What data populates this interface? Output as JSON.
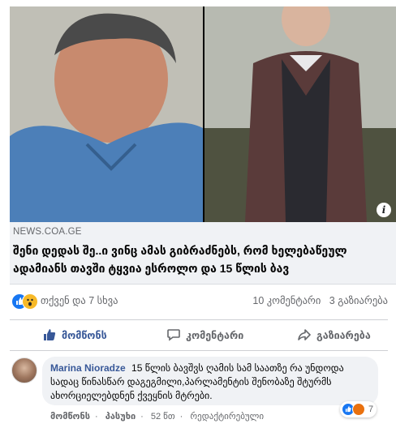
{
  "post": {
    "source": "NEWS.COA.GE",
    "headline": "შენი დედას შე..ი ვინც ამას გიბრაძნებს, რომ ხელებაწეულ ადამიანს თავში ტყვია ესროლო და 15 წლის ბავ",
    "info_icon": "i"
  },
  "reactions": {
    "summary": "თქვენ და 7 სხვა",
    "comments": "10 კომენტარი",
    "shares": "3 გაზიარება"
  },
  "actions": {
    "like": "მომწონს",
    "comment": "კომენტარი",
    "share": "გაზიარება"
  },
  "comment": {
    "author": "Marina Nioradze",
    "text": "15 წლის ბავშვს ღამის სამ საათზე რა უნდოდა სადაც წინასწარ დაგეგმილი,პარლამენტის შენობაზე შტურმს ახორციელებდნენ ქვეყნის მტრები.",
    "reaction_count": "7",
    "like_label": "მომწონს",
    "reply_label": "პასუხი",
    "time": "52 წთ",
    "edited": "რედაქტირებული"
  },
  "colors": {
    "accent": "#1877f2",
    "like_active": "#385898"
  }
}
